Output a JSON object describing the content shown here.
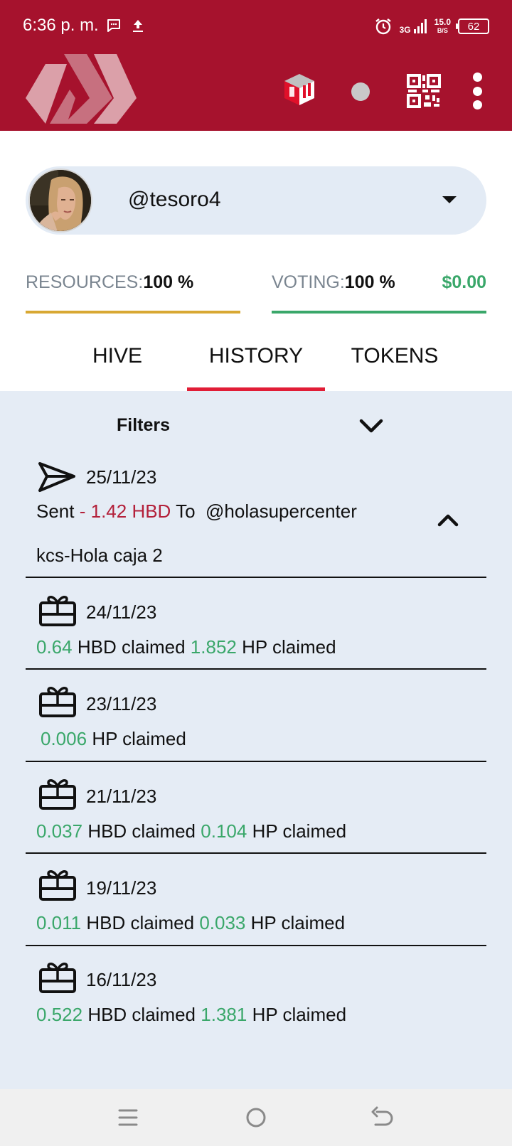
{
  "status_bar": {
    "time": "6:36 p. m.",
    "network": "3G",
    "speed_value": "15.0",
    "speed_unit": "B/S",
    "battery": "62"
  },
  "header": {
    "logo_icon": "hive-logo-icon",
    "icons": [
      "wallet-cube-icon",
      "status-dot-icon",
      "qr-code-icon",
      "more-vert-icon"
    ],
    "brand_color": "#a6122d"
  },
  "account": {
    "username": "@tesoro4"
  },
  "stats": {
    "resources_label": "RESOURCES:",
    "resources_value": "100 %",
    "voting_label": "VOTING:",
    "voting_value": "100 %",
    "vote_value_usd": "$0.00"
  },
  "tabs": [
    {
      "label": "HIVE",
      "active": false
    },
    {
      "label": "HISTORY",
      "active": true
    },
    {
      "label": "TOKENS",
      "active": false
    }
  ],
  "filters": {
    "label": "Filters"
  },
  "transactions": [
    {
      "type": "transfer",
      "icon": "send-icon",
      "date": "25/11/23",
      "prefix": "Sent",
      "amount": "- 1.42 HBD",
      "to_label": "To",
      "to_account": "@holasupercenter",
      "memo": "kcs-Hola caja 2"
    },
    {
      "type": "claim",
      "icon": "gift-icon",
      "date": "24/11/23",
      "hbd": "0.64",
      "hbd_label": "HBD claimed",
      "hp": "1.852",
      "hp_label": "HP claimed"
    },
    {
      "type": "claim",
      "icon": "gift-icon",
      "date": "23/11/23",
      "hp": "0.006",
      "hp_label": "HP claimed"
    },
    {
      "type": "claim",
      "icon": "gift-icon",
      "date": "21/11/23",
      "hbd": "0.037",
      "hbd_label": "HBD claimed",
      "hp": "0.104",
      "hp_label": "HP claimed"
    },
    {
      "type": "claim",
      "icon": "gift-icon",
      "date": "19/11/23",
      "hbd": "0.011",
      "hbd_label": "HBD claimed",
      "hp": "0.033",
      "hp_label": "HP claimed"
    },
    {
      "type": "claim",
      "icon": "gift-icon",
      "date": "16/11/23",
      "hbd": "0.522",
      "hbd_label": "HBD claimed",
      "hp": "1.381",
      "hp_label": "HP claimed"
    }
  ],
  "navbar": {
    "icons": [
      "recent-apps-icon",
      "home-icon",
      "back-icon"
    ]
  }
}
